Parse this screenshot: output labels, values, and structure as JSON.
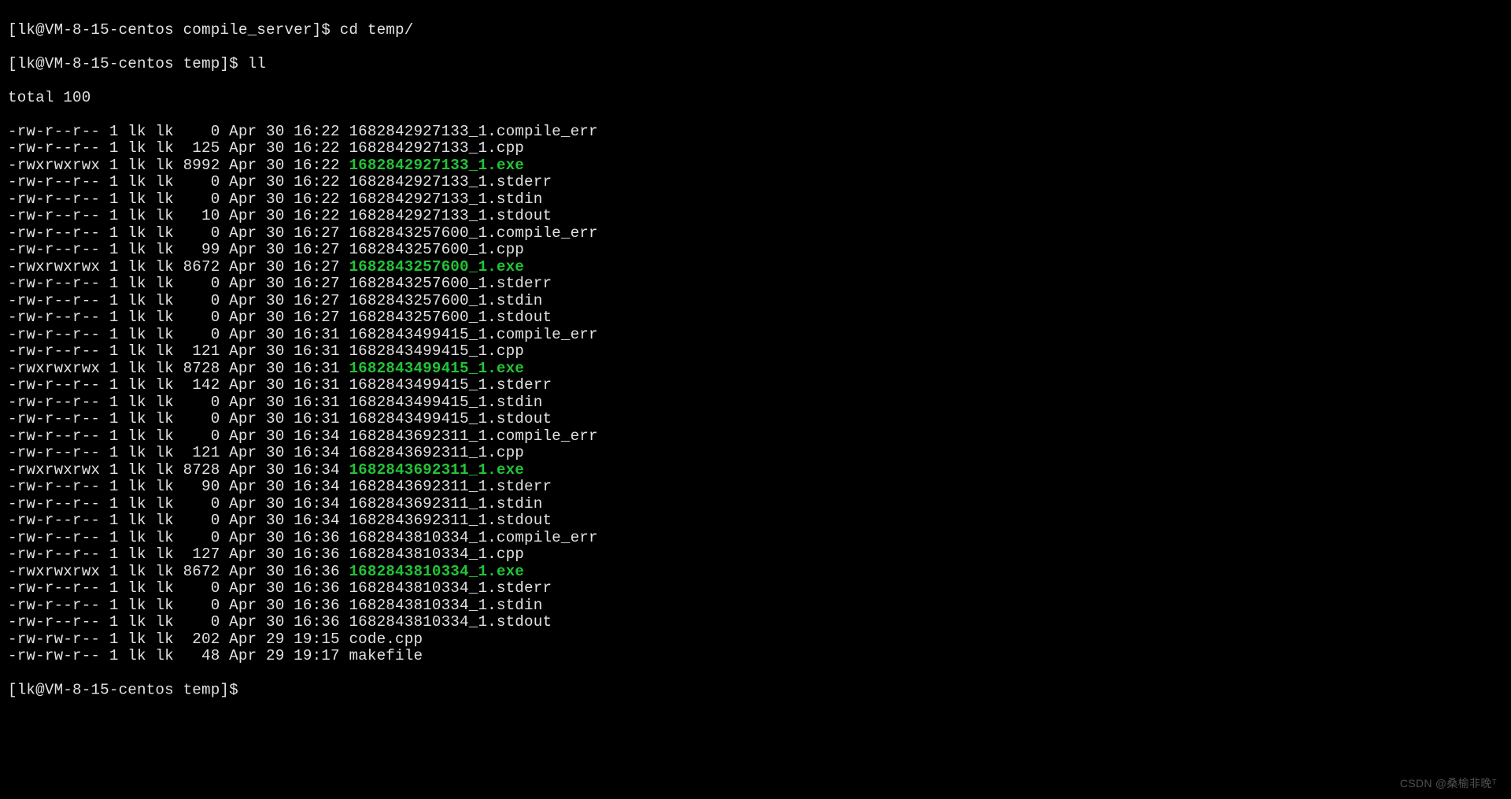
{
  "prompts": {
    "p1_prefix": "[lk@VM-8-15-centos compile_server]$ ",
    "p1_cmd": "cd temp/",
    "p2_prefix": "[lk@VM-8-15-centos temp]$ ",
    "p2_cmd": "ll",
    "p3_prefix": "[lk@VM-8-15-centos temp]$ "
  },
  "total_line": "total 100",
  "files": [
    {
      "perm": "-rw-r--r--",
      "links": "1",
      "owner": "lk",
      "group": "lk",
      "size": "0",
      "month": "Apr",
      "day": "30",
      "time": "16:22",
      "name": "1682842927133_1.compile_err",
      "exe": false
    },
    {
      "perm": "-rw-r--r--",
      "links": "1",
      "owner": "lk",
      "group": "lk",
      "size": "125",
      "month": "Apr",
      "day": "30",
      "time": "16:22",
      "name": "1682842927133_1.cpp",
      "exe": false
    },
    {
      "perm": "-rwxrwxrwx",
      "links": "1",
      "owner": "lk",
      "group": "lk",
      "size": "8992",
      "month": "Apr",
      "day": "30",
      "time": "16:22",
      "name": "1682842927133_1.exe",
      "exe": true
    },
    {
      "perm": "-rw-r--r--",
      "links": "1",
      "owner": "lk",
      "group": "lk",
      "size": "0",
      "month": "Apr",
      "day": "30",
      "time": "16:22",
      "name": "1682842927133_1.stderr",
      "exe": false
    },
    {
      "perm": "-rw-r--r--",
      "links": "1",
      "owner": "lk",
      "group": "lk",
      "size": "0",
      "month": "Apr",
      "day": "30",
      "time": "16:22",
      "name": "1682842927133_1.stdin",
      "exe": false
    },
    {
      "perm": "-rw-r--r--",
      "links": "1",
      "owner": "lk",
      "group": "lk",
      "size": "10",
      "month": "Apr",
      "day": "30",
      "time": "16:22",
      "name": "1682842927133_1.stdout",
      "exe": false
    },
    {
      "perm": "-rw-r--r--",
      "links": "1",
      "owner": "lk",
      "group": "lk",
      "size": "0",
      "month": "Apr",
      "day": "30",
      "time": "16:27",
      "name": "1682843257600_1.compile_err",
      "exe": false
    },
    {
      "perm": "-rw-r--r--",
      "links": "1",
      "owner": "lk",
      "group": "lk",
      "size": "99",
      "month": "Apr",
      "day": "30",
      "time": "16:27",
      "name": "1682843257600_1.cpp",
      "exe": false
    },
    {
      "perm": "-rwxrwxrwx",
      "links": "1",
      "owner": "lk",
      "group": "lk",
      "size": "8672",
      "month": "Apr",
      "day": "30",
      "time": "16:27",
      "name": "1682843257600_1.exe",
      "exe": true
    },
    {
      "perm": "-rw-r--r--",
      "links": "1",
      "owner": "lk",
      "group": "lk",
      "size": "0",
      "month": "Apr",
      "day": "30",
      "time": "16:27",
      "name": "1682843257600_1.stderr",
      "exe": false
    },
    {
      "perm": "-rw-r--r--",
      "links": "1",
      "owner": "lk",
      "group": "lk",
      "size": "0",
      "month": "Apr",
      "day": "30",
      "time": "16:27",
      "name": "1682843257600_1.stdin",
      "exe": false
    },
    {
      "perm": "-rw-r--r--",
      "links": "1",
      "owner": "lk",
      "group": "lk",
      "size": "0",
      "month": "Apr",
      "day": "30",
      "time": "16:27",
      "name": "1682843257600_1.stdout",
      "exe": false
    },
    {
      "perm": "-rw-r--r--",
      "links": "1",
      "owner": "lk",
      "group": "lk",
      "size": "0",
      "month": "Apr",
      "day": "30",
      "time": "16:31",
      "name": "1682843499415_1.compile_err",
      "exe": false
    },
    {
      "perm": "-rw-r--r--",
      "links": "1",
      "owner": "lk",
      "group": "lk",
      "size": "121",
      "month": "Apr",
      "day": "30",
      "time": "16:31",
      "name": "1682843499415_1.cpp",
      "exe": false
    },
    {
      "perm": "-rwxrwxrwx",
      "links": "1",
      "owner": "lk",
      "group": "lk",
      "size": "8728",
      "month": "Apr",
      "day": "30",
      "time": "16:31",
      "name": "1682843499415_1.exe",
      "exe": true
    },
    {
      "perm": "-rw-r--r--",
      "links": "1",
      "owner": "lk",
      "group": "lk",
      "size": "142",
      "month": "Apr",
      "day": "30",
      "time": "16:31",
      "name": "1682843499415_1.stderr",
      "exe": false
    },
    {
      "perm": "-rw-r--r--",
      "links": "1",
      "owner": "lk",
      "group": "lk",
      "size": "0",
      "month": "Apr",
      "day": "30",
      "time": "16:31",
      "name": "1682843499415_1.stdin",
      "exe": false
    },
    {
      "perm": "-rw-r--r--",
      "links": "1",
      "owner": "lk",
      "group": "lk",
      "size": "0",
      "month": "Apr",
      "day": "30",
      "time": "16:31",
      "name": "1682843499415_1.stdout",
      "exe": false
    },
    {
      "perm": "-rw-r--r--",
      "links": "1",
      "owner": "lk",
      "group": "lk",
      "size": "0",
      "month": "Apr",
      "day": "30",
      "time": "16:34",
      "name": "1682843692311_1.compile_err",
      "exe": false
    },
    {
      "perm": "-rw-r--r--",
      "links": "1",
      "owner": "lk",
      "group": "lk",
      "size": "121",
      "month": "Apr",
      "day": "30",
      "time": "16:34",
      "name": "1682843692311_1.cpp",
      "exe": false
    },
    {
      "perm": "-rwxrwxrwx",
      "links": "1",
      "owner": "lk",
      "group": "lk",
      "size": "8728",
      "month": "Apr",
      "day": "30",
      "time": "16:34",
      "name": "1682843692311_1.exe",
      "exe": true
    },
    {
      "perm": "-rw-r--r--",
      "links": "1",
      "owner": "lk",
      "group": "lk",
      "size": "90",
      "month": "Apr",
      "day": "30",
      "time": "16:34",
      "name": "1682843692311_1.stderr",
      "exe": false
    },
    {
      "perm": "-rw-r--r--",
      "links": "1",
      "owner": "lk",
      "group": "lk",
      "size": "0",
      "month": "Apr",
      "day": "30",
      "time": "16:34",
      "name": "1682843692311_1.stdin",
      "exe": false
    },
    {
      "perm": "-rw-r--r--",
      "links": "1",
      "owner": "lk",
      "group": "lk",
      "size": "0",
      "month": "Apr",
      "day": "30",
      "time": "16:34",
      "name": "1682843692311_1.stdout",
      "exe": false
    },
    {
      "perm": "-rw-r--r--",
      "links": "1",
      "owner": "lk",
      "group": "lk",
      "size": "0",
      "month": "Apr",
      "day": "30",
      "time": "16:36",
      "name": "1682843810334_1.compile_err",
      "exe": false
    },
    {
      "perm": "-rw-r--r--",
      "links": "1",
      "owner": "lk",
      "group": "lk",
      "size": "127",
      "month": "Apr",
      "day": "30",
      "time": "16:36",
      "name": "1682843810334_1.cpp",
      "exe": false
    },
    {
      "perm": "-rwxrwxrwx",
      "links": "1",
      "owner": "lk",
      "group": "lk",
      "size": "8672",
      "month": "Apr",
      "day": "30",
      "time": "16:36",
      "name": "1682843810334_1.exe",
      "exe": true
    },
    {
      "perm": "-rw-r--r--",
      "links": "1",
      "owner": "lk",
      "group": "lk",
      "size": "0",
      "month": "Apr",
      "day": "30",
      "time": "16:36",
      "name": "1682843810334_1.stderr",
      "exe": false
    },
    {
      "perm": "-rw-r--r--",
      "links": "1",
      "owner": "lk",
      "group": "lk",
      "size": "0",
      "month": "Apr",
      "day": "30",
      "time": "16:36",
      "name": "1682843810334_1.stdin",
      "exe": false
    },
    {
      "perm": "-rw-r--r--",
      "links": "1",
      "owner": "lk",
      "group": "lk",
      "size": "0",
      "month": "Apr",
      "day": "30",
      "time": "16:36",
      "name": "1682843810334_1.stdout",
      "exe": false
    },
    {
      "perm": "-rw-rw-r--",
      "links": "1",
      "owner": "lk",
      "group": "lk",
      "size": "202",
      "month": "Apr",
      "day": "29",
      "time": "19:15",
      "name": "code.cpp",
      "exe": false
    },
    {
      "perm": "-rw-rw-r--",
      "links": "1",
      "owner": "lk",
      "group": "lk",
      "size": "48",
      "month": "Apr",
      "day": "29",
      "time": "19:17",
      "name": "makefile",
      "exe": false
    }
  ],
  "watermark": "CSDN @桑榆非晚ᵀ"
}
